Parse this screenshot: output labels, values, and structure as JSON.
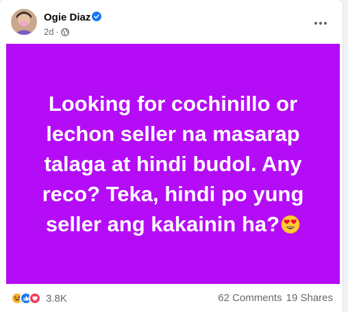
{
  "post": {
    "author": "Ogie Diaz",
    "time": "2d",
    "separator": "·",
    "privacy_icon": "globe-icon",
    "verified_icon": "verified-badge-icon",
    "more_icon": "more-options-icon",
    "background_color": "#b50cf7",
    "text": "Looking for cochinillo or lechon seller na masarap talaga at hindi budol. Any reco? Teka, hindi po yung seller ang kakainin ha?",
    "emoji": "heart-eyes-emoji"
  },
  "footer": {
    "reaction_icons": [
      "haha-icon",
      "like-icon",
      "love-icon"
    ],
    "reaction_count": "3.8K",
    "comments": "62 Comments",
    "shares": "19 Shares"
  },
  "colors": {
    "accent": "#1877f2",
    "text_primary": "#050505",
    "text_secondary": "#65676b"
  }
}
